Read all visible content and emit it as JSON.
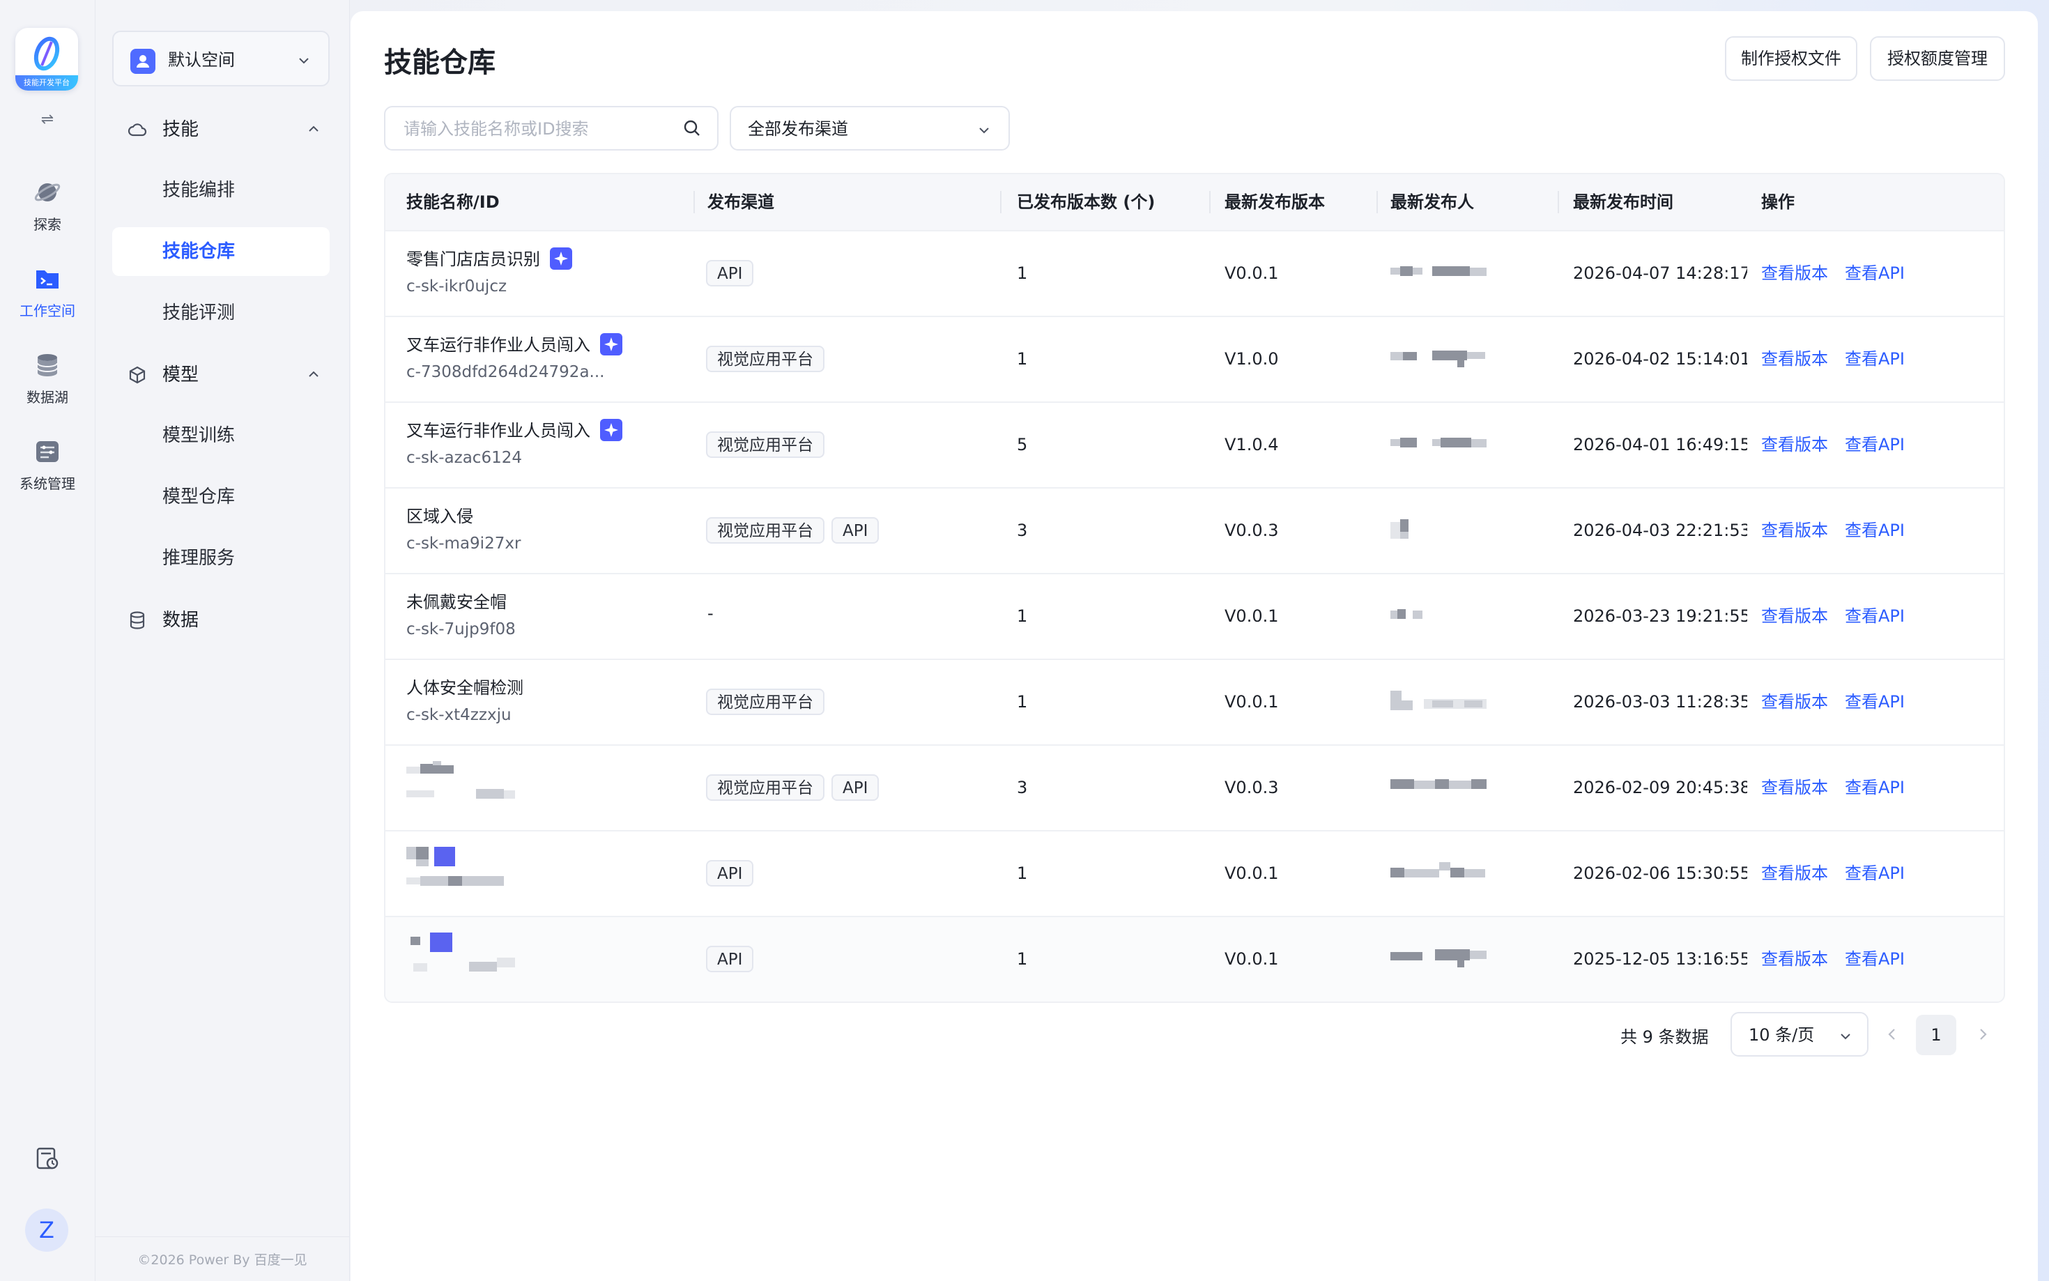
{
  "rail": {
    "logo_caption": "技能开发平台",
    "items": [
      {
        "label": "探索",
        "icon": "planet-icon"
      },
      {
        "label": "工作空间",
        "icon": "folder-terminal-icon"
      },
      {
        "label": "数据湖",
        "icon": "database-icon"
      },
      {
        "label": "系统管理",
        "icon": "settings-panel-icon"
      }
    ],
    "active_item": "工作空间",
    "avatar_letter": "Z"
  },
  "sidebar": {
    "space_name": "默认空间",
    "groups": [
      {
        "label": "技能",
        "icon": "cloud-icon",
        "expanded": true,
        "items": [
          "技能编排",
          "技能仓库",
          "技能评测"
        ]
      },
      {
        "label": "模型",
        "icon": "cube-icon",
        "expanded": true,
        "items": [
          "模型训练",
          "模型仓库",
          "推理服务"
        ]
      },
      {
        "label": "数据",
        "icon": "database-icon",
        "expanded": false,
        "items": []
      }
    ],
    "active_item": "技能仓库",
    "copyright": "©2026 Power By 百度一见"
  },
  "page": {
    "title": "技能仓库",
    "buttons": {
      "make_auth": "制作授权文件",
      "auth_quota": "授权额度管理"
    },
    "search_placeholder": "请输入技能名称或ID搜索",
    "channel_filter": "全部发布渠道"
  },
  "table": {
    "columns": [
      "技能名称/ID",
      "发布渠道",
      "已发布版本数 (个)",
      "最新发布版本",
      "最新发布人",
      "最新发布时间",
      "操作"
    ],
    "action_labels": {
      "view_version": "查看版本",
      "view_api": "查看API"
    },
    "rows": [
      {
        "name": "零售门店店员识别",
        "id": "c-sk-ikr0ujcz",
        "ai": true,
        "channels": [
          "API"
        ],
        "count": "1",
        "version": "V0.0.1",
        "time": "2026-04-07 14:28:17"
      },
      {
        "name": "叉车运行非作业人员闯入",
        "id": "c-7308dfd264d24792a...",
        "ai": true,
        "channels": [
          "视觉应用平台"
        ],
        "count": "1",
        "version": "V1.0.0",
        "time": "2026-04-02 15:14:01"
      },
      {
        "name": "叉车运行非作业人员闯入",
        "id": "c-sk-azac6124",
        "ai": true,
        "channels": [
          "视觉应用平台"
        ],
        "count": "5",
        "version": "V1.0.4",
        "time": "2026-04-01 16:49:15"
      },
      {
        "name": "区域入侵",
        "id": "c-sk-ma9i27xr",
        "ai": false,
        "channels": [
          "视觉应用平台",
          "API"
        ],
        "count": "3",
        "version": "V0.0.3",
        "time": "2026-04-03 22:21:53"
      },
      {
        "name": "未佩戴安全帽",
        "id": "c-sk-7ujp9f08",
        "ai": false,
        "channels": [],
        "channel_empty": "-",
        "count": "1",
        "version": "V0.0.1",
        "time": "2026-03-23 19:21:55"
      },
      {
        "name": "人体安全帽检测",
        "id": "c-sk-xt4zzxju",
        "ai": false,
        "channels": [
          "视觉应用平台"
        ],
        "count": "1",
        "version": "V0.0.1",
        "time": "2026-03-03 11:28:35"
      },
      {
        "name": "",
        "id": "",
        "ai": false,
        "redacted": true,
        "channels": [
          "视觉应用平台",
          "API"
        ],
        "count": "3",
        "version": "V0.0.3",
        "time": "2026-02-09 20:45:38"
      },
      {
        "name": "",
        "id": "",
        "ai": false,
        "redacted": true,
        "channels": [
          "API"
        ],
        "count": "1",
        "version": "V0.0.1",
        "time": "2026-02-06 15:30:55"
      },
      {
        "name": "",
        "id": "",
        "ai": false,
        "redacted": true,
        "channels": [
          "API"
        ],
        "count": "1",
        "version": "V0.0.1",
        "time": "2025-12-05 13:16:55"
      }
    ]
  },
  "pagination": {
    "total_text": "共 9 条数据",
    "page_size": "10 条/页",
    "current_page": "1"
  },
  "colors": {
    "accent": "#2b5cff",
    "ai_badge": "#4f5dff"
  }
}
